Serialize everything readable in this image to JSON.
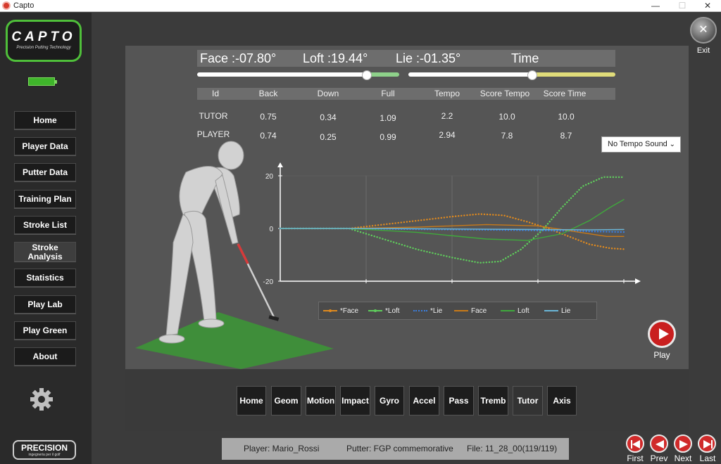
{
  "window": {
    "title": "Capto",
    "minimize": "—",
    "maximize": "☐",
    "close": "✕"
  },
  "brand": {
    "logo_main": "CAPTO",
    "logo_sub": "Precision Putting Technology",
    "footer_main": "PRECISION",
    "footer_sub": "ingegneria per il golf"
  },
  "sidebar": {
    "items": [
      {
        "label": "Home"
      },
      {
        "label": "Player Data"
      },
      {
        "label": "Putter Data"
      },
      {
        "label": "Training Plan"
      },
      {
        "label": "Stroke List"
      },
      {
        "label": "Stroke Analysis"
      },
      {
        "label": "Statistics"
      },
      {
        "label": "Play Lab"
      },
      {
        "label": "Play Green"
      },
      {
        "label": "About"
      }
    ]
  },
  "readout": {
    "face": "Face :-07.80°",
    "loft": "Loft :19.44°",
    "lie": "Lie  :-01.35°",
    "time": "Time"
  },
  "sliders": [
    {
      "value": 0.84,
      "fill": "#ffffff",
      "track": "#8ed18a"
    },
    {
      "value": 0.6,
      "fill": "#ffffff",
      "track": "#e0dc7a"
    }
  ],
  "table": {
    "columns": [
      "Id",
      "Back",
      "Down",
      "Full",
      "Tempo",
      "Score Tempo",
      "Score Time"
    ],
    "rows": [
      [
        "TUTOR",
        "0.75",
        "0.34",
        "1.09",
        "2.2",
        "10.0",
        "10.0"
      ],
      [
        "PLAYER",
        "0.74",
        "0.25",
        "0.99",
        "2.94",
        "7.8",
        "8.7"
      ]
    ]
  },
  "tempo_select": {
    "value": "No Tempo Sound"
  },
  "exit_label": "Exit",
  "play_label": "Play",
  "chart_data": {
    "type": "line",
    "ylim": [
      -20,
      20
    ],
    "yticks": [
      "20",
      "0",
      "-20"
    ],
    "xlim": [
      0,
      100
    ],
    "series": [
      {
        "name": "*Face",
        "color": "#e08a1e",
        "dotted": true,
        "points": [
          [
            0,
            0
          ],
          [
            10,
            0
          ],
          [
            20,
            0
          ],
          [
            30,
            1.5
          ],
          [
            40,
            3
          ],
          [
            50,
            4.5
          ],
          [
            58,
            5.5
          ],
          [
            65,
            5
          ],
          [
            72,
            2.5
          ],
          [
            78,
            0
          ],
          [
            84,
            -3
          ],
          [
            90,
            -6
          ],
          [
            96,
            -7.5
          ],
          [
            100,
            -7.8
          ]
        ]
      },
      {
        "name": "*Loft",
        "color": "#5fce5c",
        "dotted": true,
        "points": [
          [
            0,
            0
          ],
          [
            10,
            0
          ],
          [
            20,
            0
          ],
          [
            30,
            -4
          ],
          [
            40,
            -8
          ],
          [
            50,
            -11
          ],
          [
            58,
            -13
          ],
          [
            64,
            -12.5
          ],
          [
            70,
            -8
          ],
          [
            76,
            -1
          ],
          [
            82,
            8
          ],
          [
            88,
            16
          ],
          [
            94,
            19.5
          ],
          [
            100,
            19.44
          ]
        ]
      },
      {
        "name": "*Lie",
        "color": "#3a7ee0",
        "dotted": true,
        "points": [
          [
            0,
            0
          ],
          [
            20,
            0
          ],
          [
            40,
            -0.3
          ],
          [
            60,
            -0.5
          ],
          [
            80,
            -0.8
          ],
          [
            100,
            -1.35
          ]
        ]
      },
      {
        "name": "Face",
        "color": "#c97a18",
        "dotted": false,
        "points": [
          [
            0,
            0
          ],
          [
            20,
            0
          ],
          [
            40,
            0.5
          ],
          [
            60,
            1.5
          ],
          [
            75,
            1
          ],
          [
            85,
            -1
          ],
          [
            95,
            -3
          ],
          [
            100,
            -3
          ]
        ]
      },
      {
        "name": "Loft",
        "color": "#3faa3c",
        "dotted": false,
        "points": [
          [
            0,
            0
          ],
          [
            20,
            0
          ],
          [
            40,
            -1.5
          ],
          [
            60,
            -4
          ],
          [
            72,
            -4.5
          ],
          [
            82,
            -2
          ],
          [
            90,
            3
          ],
          [
            96,
            8
          ],
          [
            100,
            11
          ]
        ]
      },
      {
        "name": "Lie",
        "color": "#6ab6d8",
        "dotted": false,
        "points": [
          [
            0,
            0
          ],
          [
            30,
            0
          ],
          [
            60,
            -0.3
          ],
          [
            90,
            -0.5
          ],
          [
            100,
            -0.4
          ]
        ]
      }
    ]
  },
  "tabs": [
    {
      "label": "Home"
    },
    {
      "label": "Geom"
    },
    {
      "label": "Motion"
    },
    {
      "label": "Impact"
    },
    {
      "label": "Gyro"
    },
    {
      "label": "Accel"
    },
    {
      "label": "Pass"
    },
    {
      "label": "Tremb"
    },
    {
      "label": "Tutor",
      "active": true
    },
    {
      "label": "Axis"
    }
  ],
  "status": {
    "player": "Player: Mario_Rossi",
    "putter": "Putter: FGP commemorative",
    "file": "File: 11_28_00(119/119)"
  },
  "pagination": [
    {
      "label": "First"
    },
    {
      "label": "Prev"
    },
    {
      "label": "Next"
    },
    {
      "label": "Last"
    }
  ]
}
